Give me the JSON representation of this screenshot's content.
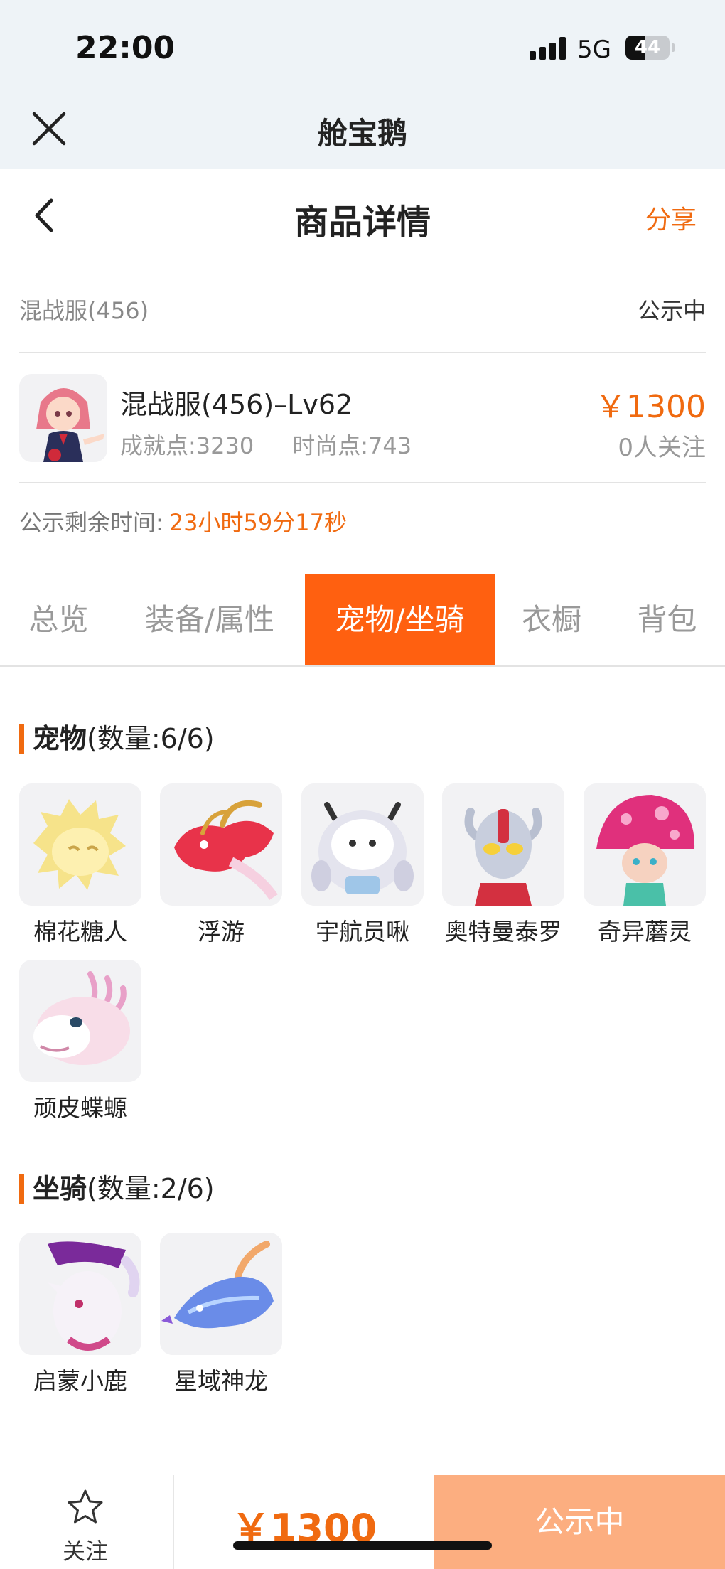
{
  "status_bar": {
    "time": "22:00",
    "network": "5G",
    "battery": "44",
    "battery_level": 0.44
  },
  "app_header": {
    "title": "舱宝鹅"
  },
  "nav": {
    "title": "商品详情",
    "share": "分享"
  },
  "listing": {
    "server": "混战服(456)",
    "status": "公示中",
    "name": "混战服(456)–Lv62",
    "achievement": "成就点:3230",
    "fashion": "时尚点:743",
    "price": "￥1300",
    "followers": "0人关注",
    "countdown_label": "公示剩余时间:",
    "countdown_value": "23小时59分17秒"
  },
  "tabs": [
    {
      "label": "总览",
      "active": false
    },
    {
      "label": "装备/属性",
      "active": false
    },
    {
      "label": "宠物/坐骑",
      "active": true
    },
    {
      "label": "衣橱",
      "active": false
    },
    {
      "label": "背包",
      "active": false
    }
  ],
  "pets": {
    "title": "宠物",
    "count": "(数量:6/6)",
    "items": [
      {
        "name": "棉花糖人",
        "icon": "cotton-candy-pet-icon"
      },
      {
        "name": "浮游",
        "icon": "red-dragon-pet-icon"
      },
      {
        "name": "宇航员啾",
        "icon": "astronaut-pet-icon"
      },
      {
        "name": "奥特曼泰罗",
        "icon": "ultraman-taro-pet-icon"
      },
      {
        "name": "奇异蘑灵",
        "icon": "mushroom-pet-icon"
      },
      {
        "name": "顽皮蝶螈",
        "icon": "axolotl-pet-icon"
      }
    ]
  },
  "mounts": {
    "title": "坐骑",
    "count": "(数量:2/6)",
    "items": [
      {
        "name": "启蒙小鹿",
        "icon": "fawn-mount-icon"
      },
      {
        "name": "星域神龙",
        "icon": "star-dragon-mount-icon"
      }
    ]
  },
  "bottom_bar": {
    "follow": "关注",
    "price": "￥1300",
    "status": "公示中"
  },
  "colors": {
    "accent": "#f06a10",
    "tab_active": "#ff6010",
    "status_button": "#fcae80",
    "header_bg": "#eef3f7"
  }
}
